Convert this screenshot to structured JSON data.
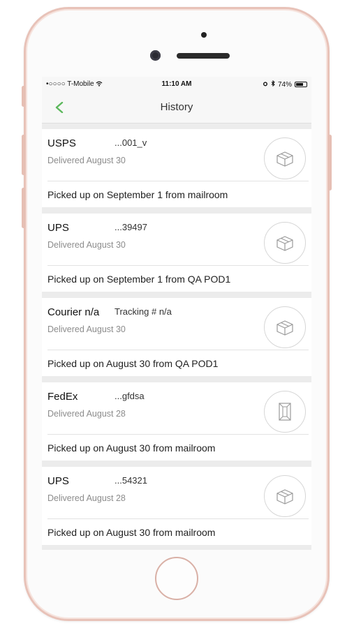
{
  "status_bar": {
    "carrier": "•○○○○ T-Mobile",
    "time": "11:10 AM",
    "battery": "74%",
    "battery_level": 0.74
  },
  "nav": {
    "title": "History",
    "back_icon": "chevron-left-icon",
    "accent_color": "#5cb85c"
  },
  "packages": [
    {
      "carrier": "USPS",
      "tracking": "...001_v",
      "delivered": "Delivered August 30",
      "pickup": "Picked up on September 1 from mailroom",
      "icon": "box-icon"
    },
    {
      "carrier": "UPS",
      "tracking": "...39497",
      "delivered": "Delivered August 30",
      "pickup": "Picked up on September 1 from QA POD1",
      "icon": "box-icon"
    },
    {
      "carrier": "Courier n/a",
      "tracking": "Tracking # n/a",
      "delivered": "Delivered August 30",
      "pickup": "Picked up on August 30 from QA POD1",
      "icon": "box-icon"
    },
    {
      "carrier": "FedEx",
      "tracking": "...gfdsa",
      "delivered": "Delivered August 28",
      "pickup": "Picked up on August 30 from mailroom",
      "icon": "envelope-icon"
    },
    {
      "carrier": "UPS",
      "tracking": "...54321",
      "delivered": "Delivered August 28",
      "pickup": "Picked up on August 30 from mailroom",
      "icon": "box-icon"
    }
  ]
}
